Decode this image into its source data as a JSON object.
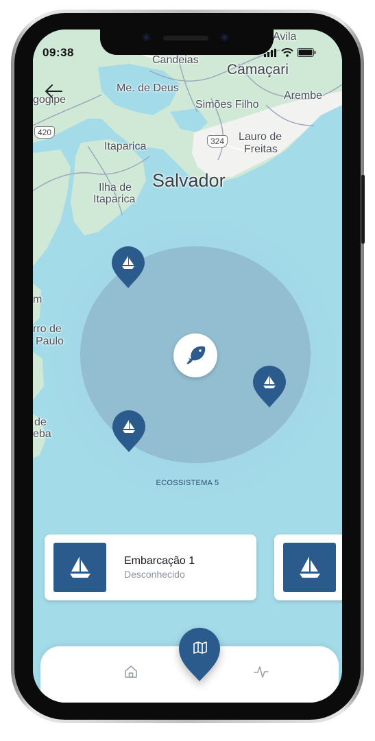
{
  "status_bar": {
    "time": "09:38"
  },
  "map": {
    "places": {
      "candeias": "Candeias",
      "camacari": "Camaçari",
      "me_de_deus": "Me. de Deus",
      "simoes_filho": "Simões Filho",
      "arembe": "Arembe",
      "gogipe": "gogipe",
      "itaparica": "Itaparica",
      "lauro_de_freitas_1": "Lauro de",
      "lauro_de_freitas_2": "Freitas",
      "salvador": "Salvador",
      "ilha_1": "Ilha de",
      "ilha_2": "Itaparica",
      "avila": "Avila",
      "m": "m",
      "morro_1": "rro de",
      "morro_2": "Paulo",
      "de": "de",
      "eba": "eba"
    },
    "shields": {
      "r420": "420",
      "r324": "324"
    }
  },
  "zone": {
    "label": "ECOSSISTEMA 5"
  },
  "cards": [
    {
      "title": "Embarcação 1",
      "subtitle": "Desconhecido"
    }
  ],
  "colors": {
    "primary": "#2b5b8c",
    "water": "#a4dbe9",
    "land": "#cfe9d6",
    "zone": "#93bdd0"
  },
  "icons": {
    "back": "arrow-left-icon",
    "pin": "sailboat-pin-icon",
    "fish": "fish-icon",
    "home": "home-icon",
    "map": "map-icon",
    "activity": "activity-icon"
  }
}
